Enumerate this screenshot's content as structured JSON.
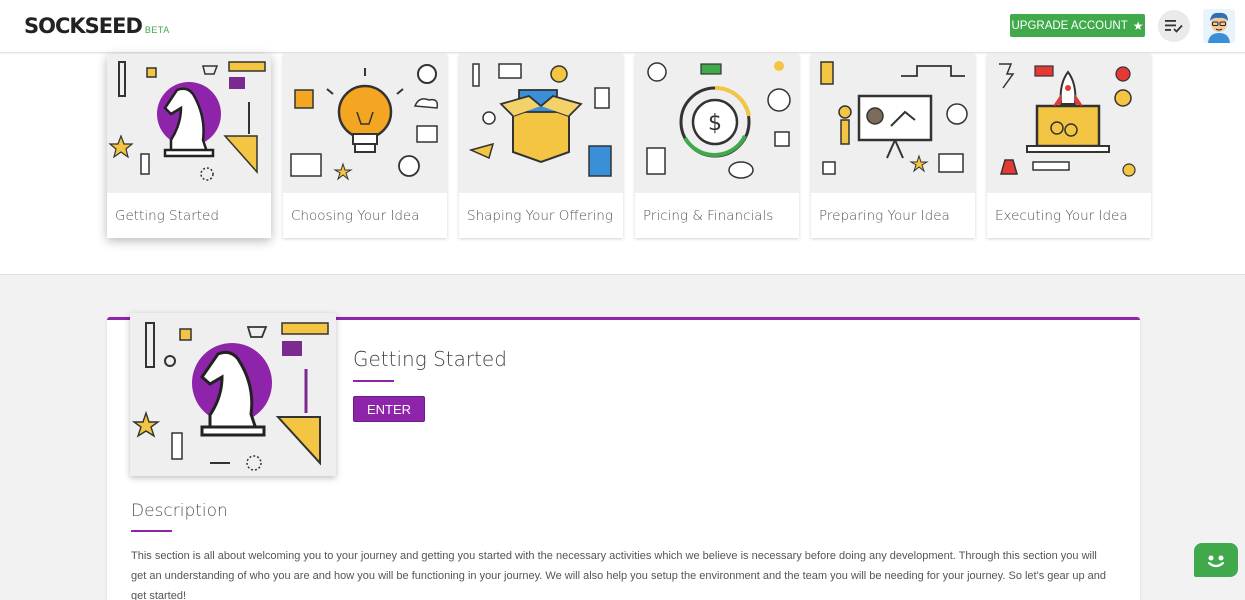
{
  "brand": {
    "logo": "SOCKSEED",
    "badge": "BETA"
  },
  "header": {
    "upgrade_label": "UPGRADE ACCOUNT",
    "upgrade_icon": "star-icon",
    "list_icon": "checklist-icon",
    "avatar_icon": "avatar-icon"
  },
  "colors": {
    "accent": "#8e24aa",
    "brand_green": "#3fa94b",
    "icon_yellow": "#f4c542"
  },
  "modules": [
    {
      "label": "Getting Started",
      "icon": "chess-knight-icon",
      "active": true
    },
    {
      "label": "Choosing Your Idea",
      "icon": "lightbulb-icon",
      "active": false
    },
    {
      "label": "Shaping Your Offering",
      "icon": "open-box-icon",
      "active": false
    },
    {
      "label": "Pricing & Financials",
      "icon": "dollar-coin-icon",
      "active": false
    },
    {
      "label": "Preparing Your Idea",
      "icon": "presentation-board-icon",
      "active": false
    },
    {
      "label": "Executing Your Idea",
      "icon": "rocket-laptop-icon",
      "active": false
    }
  ],
  "detail": {
    "title": "Getting Started",
    "enter_label": "ENTER",
    "description_heading": "Description",
    "description": "This section is all about welcoming you to your journey and getting you started with the necessary activities which we believe is necessary before doing any development. Through this section you will get an understanding of who you are and how you will be functioning in your journey. We will also help you setup the environment and the team you will be needing for your journey. So let's gear up and get started!"
  },
  "chat": {
    "icon": "chat-bot-icon"
  }
}
